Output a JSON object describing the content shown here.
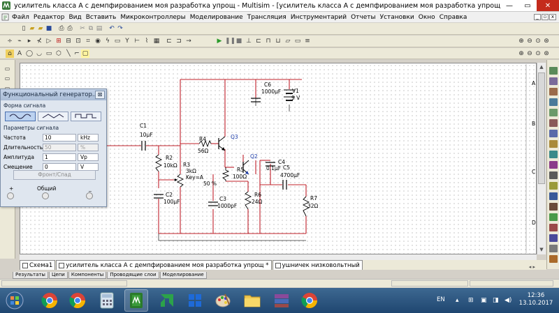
{
  "window": {
    "title": "усилитель класса А с демпфированием моя разработка упрощ - Multisim - [усилитель класса А с демпфированием моя разработка упрощ *]",
    "minimize": "—",
    "maximize": "▭",
    "close": "✕"
  },
  "menu": {
    "items": [
      "Файл",
      "Редактор",
      "Вид",
      "Вставить",
      "Микроконтроллеры",
      "Моделирование",
      "Трансляция",
      "Инструментарий",
      "Отчеты",
      "Установки",
      "Окно",
      "Справка"
    ]
  },
  "function_generator": {
    "title": "Функциональный генератор...",
    "close": "⊠",
    "waveform_label": "Форма сигнала",
    "params_label": "Параметры сигнала",
    "params": [
      {
        "name": "Частота",
        "value": "10",
        "unit": "kHz",
        "disabled": false
      },
      {
        "name": "Длительность",
        "value": "50",
        "unit": "%",
        "disabled": true
      },
      {
        "name": "Амплитуда",
        "value": "1",
        "unit": "Vp",
        "disabled": false
      },
      {
        "name": "Смещение",
        "value": "0",
        "unit": "V",
        "disabled": false
      }
    ],
    "front_button": "Фронт/Спад",
    "terminal_plus": "+",
    "terminal_common": "Общий",
    "terminal_minus": "_"
  },
  "components": {
    "c1": {
      "ref": "C1",
      "val": "10µF"
    },
    "r2": {
      "ref": "R2",
      "val": "10kΩ"
    },
    "r3": {
      "ref": "R3",
      "val": "3kΩ",
      "key": "Key=A",
      "pct": "50 %"
    },
    "c2": {
      "ref": "C2",
      "val": "100µF"
    },
    "r4": {
      "ref": "R4",
      "val": "56Ω"
    },
    "q3": {
      "ref": "Q3"
    },
    "q2": {
      "ref": "Q2"
    },
    "r5": {
      "ref": "R5",
      "val": "100Ω"
    },
    "c3": {
      "ref": "C3",
      "val": "1000pF"
    },
    "c6": {
      "ref": "C6",
      "val": "1000µF"
    },
    "v1": {
      "ref": "V1",
      "val": "9 V"
    },
    "c4": {
      "ref": "C4",
      "val": "0.1µF"
    },
    "c5": {
      "ref": "C5",
      "val": "4700µF"
    },
    "r6": {
      "ref": "R6",
      "val": "24Ω"
    },
    "r7": {
      "ref": "R7",
      "val": "32Ω"
    }
  },
  "doc_tabs": [
    "Схема1",
    "усилитель класса А с демпфированием моя разработка упрощ *",
    "ушничек низковольтный"
  ],
  "bottom_tabs": [
    "Результаты",
    "Цепи",
    "Компоненты",
    "Проводящие слои",
    "Моделирование"
  ],
  "ruler_letters": [
    "A",
    "B",
    "C",
    "D"
  ],
  "taskbar": {
    "lang": "EN",
    "time": "12:36",
    "date": "13.10.2017",
    "apps": [
      "start",
      "chrome",
      "chrome",
      "calculator",
      "multisim",
      "amd",
      "windows-apps",
      "paint",
      "folder",
      "archiver",
      "chrome"
    ]
  }
}
